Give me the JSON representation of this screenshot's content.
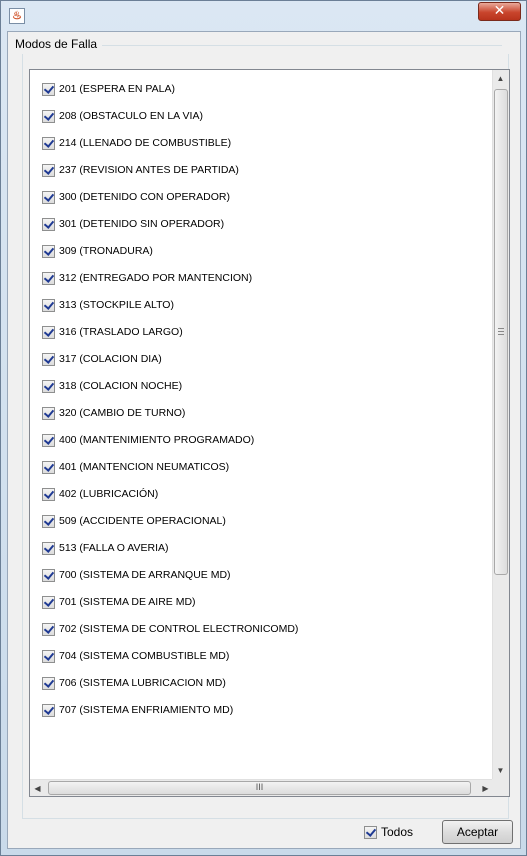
{
  "window": {
    "title": ""
  },
  "group": {
    "title": "Modos de Falla"
  },
  "items": [
    {
      "label": "201 (ESPERA EN PALA)",
      "checked": true
    },
    {
      "label": "208 (OBSTACULO EN LA VIA)",
      "checked": true
    },
    {
      "label": "214 (LLENADO DE COMBUSTIBLE)",
      "checked": true
    },
    {
      "label": "237 (REVISION ANTES DE PARTIDA)",
      "checked": true
    },
    {
      "label": "300 (DETENIDO CON OPERADOR)",
      "checked": true
    },
    {
      "label": "301 (DETENIDO SIN OPERADOR)",
      "checked": true
    },
    {
      "label": "309 (TRONADURA)",
      "checked": true
    },
    {
      "label": "312 (ENTREGADO POR MANTENCION)",
      "checked": true
    },
    {
      "label": "313 (STOCKPILE ALTO)",
      "checked": true
    },
    {
      "label": "316 (TRASLADO LARGO)",
      "checked": true
    },
    {
      "label": "317 (COLACION DIA)",
      "checked": true
    },
    {
      "label": "318 (COLACION NOCHE)",
      "checked": true
    },
    {
      "label": "320 (CAMBIO DE TURNO)",
      "checked": true
    },
    {
      "label": "400 (MANTENIMIENTO PROGRAMADO)",
      "checked": true
    },
    {
      "label": "401 (MANTENCION NEUMATICOS)",
      "checked": true
    },
    {
      "label": "402 (LUBRICACIÓN)",
      "checked": true
    },
    {
      "label": "509 (ACCIDENTE OPERACIONAL)",
      "checked": true
    },
    {
      "label": "513 (FALLA O AVERIA)",
      "checked": true
    },
    {
      "label": "700 (SISTEMA DE ARRANQUE MD)",
      "checked": true
    },
    {
      "label": "701 (SISTEMA DE AIRE MD)",
      "checked": true
    },
    {
      "label": "702 (SISTEMA DE CONTROL ELECTRONICOMD)",
      "checked": true
    },
    {
      "label": "704 (SISTEMA COMBUSTIBLE MD)",
      "checked": true
    },
    {
      "label": "706 (SISTEMA LUBRICACION MD)",
      "checked": true
    },
    {
      "label": "707 (SISTEMA ENFRIAMIENTO MD)",
      "checked": true
    }
  ],
  "footer": {
    "todos_label": "Todos",
    "todos_checked": true,
    "accept_label": "Aceptar"
  },
  "scrollbar": {
    "h_grip": "III"
  },
  "icons": {
    "close": "✕",
    "up": "▲",
    "down": "▼",
    "left": "◀",
    "right": "▶"
  }
}
